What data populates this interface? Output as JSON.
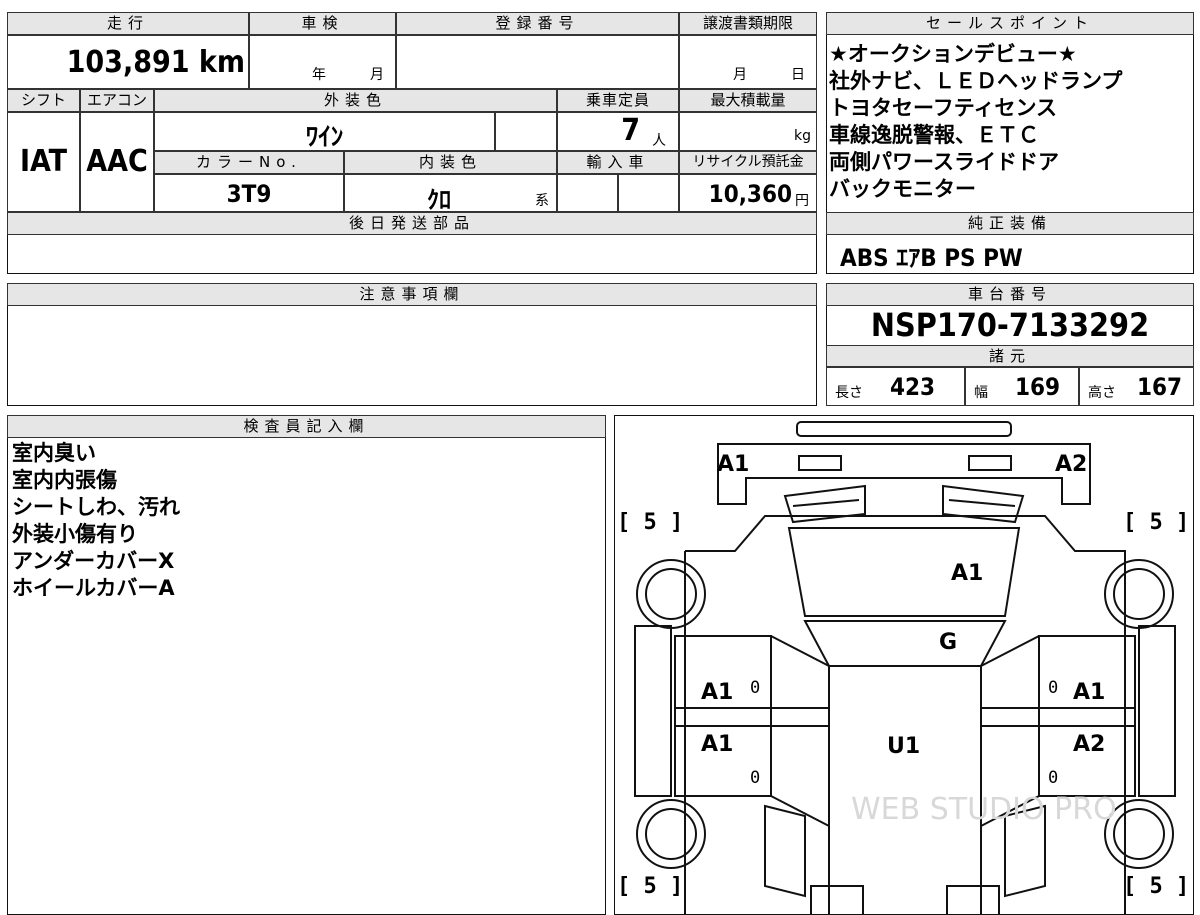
{
  "info": {
    "mileage_label": "走行",
    "inspection_label": "車検",
    "registration_label": "登録番号",
    "transfer_deadline_label": "譲渡書類期限",
    "mileage_value": "103,891 km",
    "year_unit": "年",
    "month_unit": "月",
    "deadline_month": "月",
    "deadline_day": "日",
    "shift_label": "シフト",
    "ac_label": "エアコン",
    "exterior_color_label": "外装色",
    "capacity_label": "乗車定員",
    "max_load_label": "最大積載量",
    "shift_value": "IAT",
    "ac_value": "AAC",
    "exterior_color_value": "ﾜｲﾝ",
    "capacity_value": "7",
    "capacity_unit": "人",
    "load_unit": "kg",
    "color_no_label": "カラーNo.",
    "interior_color_label": "内装色",
    "import_label": "輸入車",
    "recycle_label": "リサイクル預託金",
    "color_no_value": "3T9",
    "interior_color_value": "ｸﾛ",
    "interior_suffix": "系",
    "recycle_value": "10,360",
    "recycle_unit": "円",
    "later_parts_label": "後日発送部品"
  },
  "sales_points": {
    "header": "セールスポイント",
    "lines": [
      "★オークションデビュー★",
      "社外ナビ、ＬＥＤヘッドランプ",
      "トヨタセーフティセンス",
      "車線逸脱警報、ＥＴＣ",
      "両側パワースライドドア",
      "バックモニター"
    ]
  },
  "genuine_equipment": {
    "header": "純正装備",
    "value": "ABS ｴｱB PS PW"
  },
  "caution": {
    "header": "注意事項欄"
  },
  "chassis": {
    "header": "車台番号",
    "value": "NSP170-7133292",
    "spec_header": "諸元",
    "length_label": "長さ",
    "length_value": "423",
    "width_label": "幅",
    "width_value": "169",
    "height_label": "高さ",
    "height_value": "167"
  },
  "inspector": {
    "header": "検査員記入欄",
    "notes": [
      "室内臭い",
      "室内内張傷",
      "シートしわ、汚れ",
      "外装小傷有り",
      "アンダーカバーX",
      "ホイールカバーA"
    ]
  },
  "diagram": {
    "marks": {
      "front_left": "A1",
      "front_right": "A2",
      "hood": "A1",
      "windshield": "G",
      "front_door_left": "A1",
      "front_door_right": "A1",
      "rear_door_left": "A1",
      "rear_door_right": "A2",
      "roof": "U1"
    },
    "tire_bracket": "[ 5 ]",
    "zero": "0",
    "watermark": "WEB STUDIO PRO"
  }
}
